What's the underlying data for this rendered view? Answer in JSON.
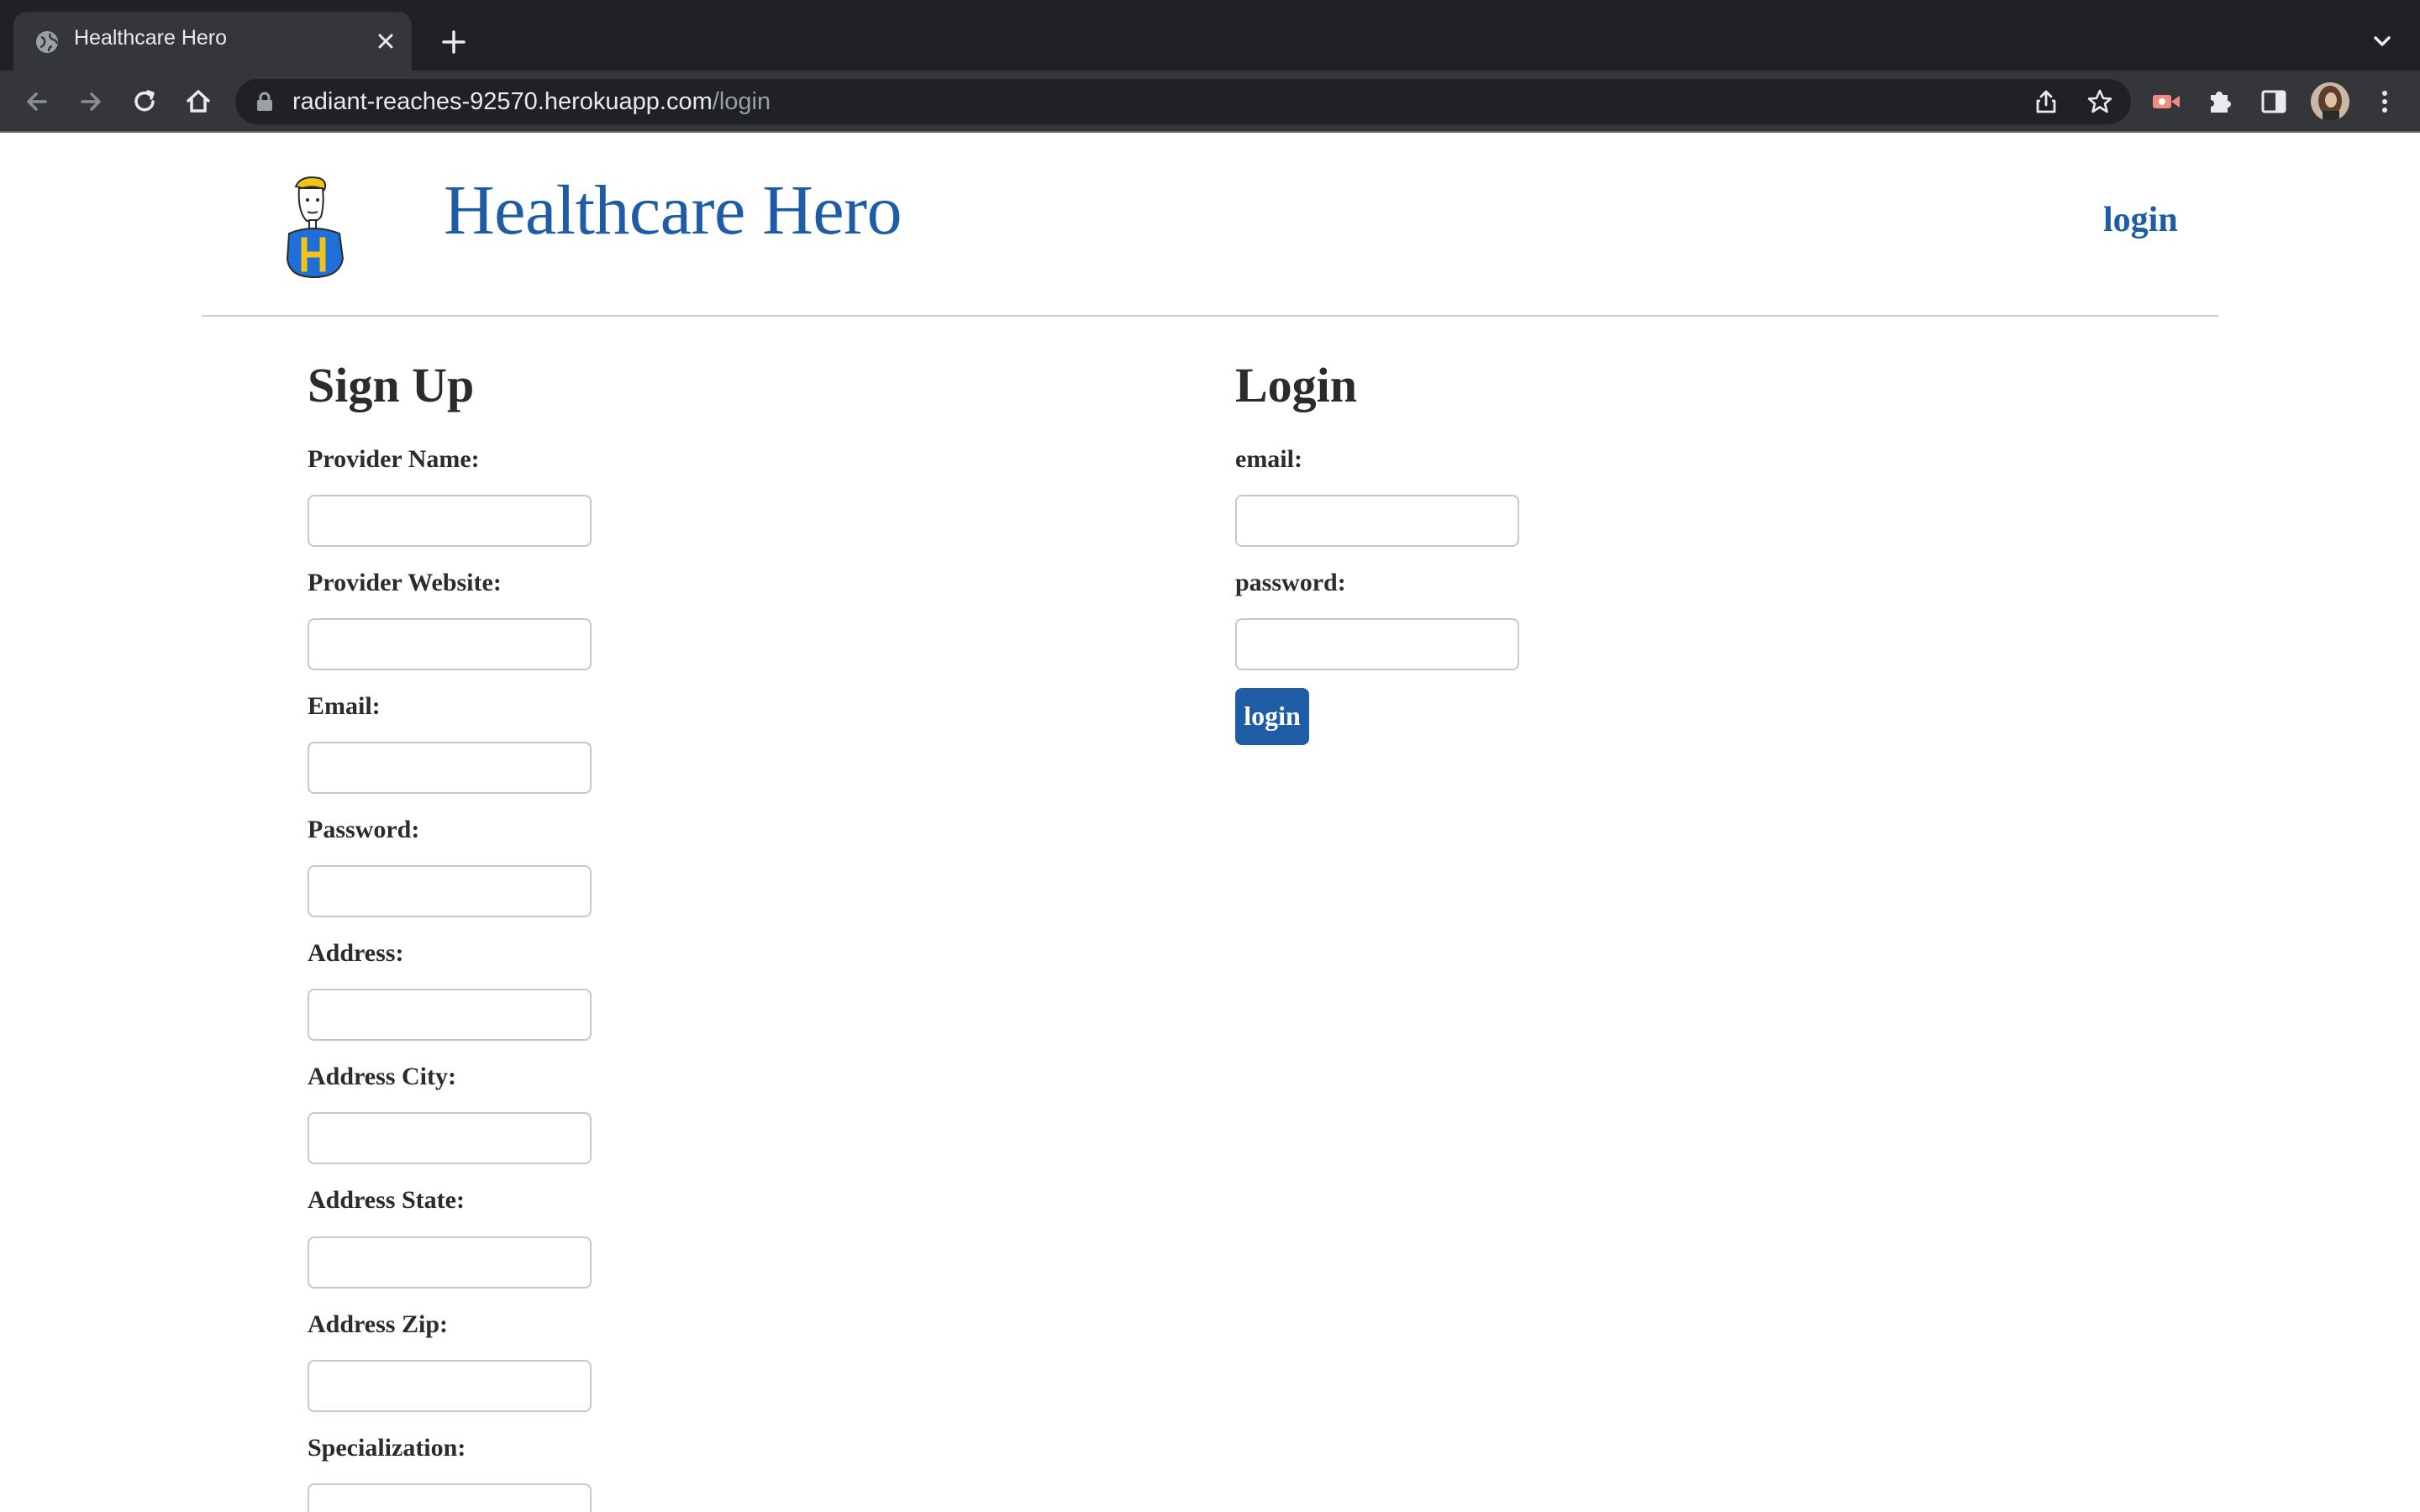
{
  "browser": {
    "tab_title": "Healthcare Hero",
    "url_host": "radiant-reaches-92570.herokuapp.com",
    "url_path": "/login"
  },
  "site": {
    "title": "Healthcare Hero",
    "nav_login": "login"
  },
  "signup": {
    "heading": "Sign Up",
    "fields": [
      {
        "label": "Provider Name:",
        "value": ""
      },
      {
        "label": "Provider Website:",
        "value": ""
      },
      {
        "label": "Email:",
        "value": ""
      },
      {
        "label": "Password:",
        "value": ""
      },
      {
        "label": "Address:",
        "value": ""
      },
      {
        "label": "Address City:",
        "value": ""
      },
      {
        "label": "Address State:",
        "value": ""
      },
      {
        "label": "Address Zip:",
        "value": ""
      },
      {
        "label": "Specialization:",
        "value": ""
      }
    ]
  },
  "login": {
    "heading": "Login",
    "fields": [
      {
        "label": "email:",
        "value": ""
      },
      {
        "label": "password:",
        "value": ""
      }
    ],
    "button_label": "login"
  }
}
